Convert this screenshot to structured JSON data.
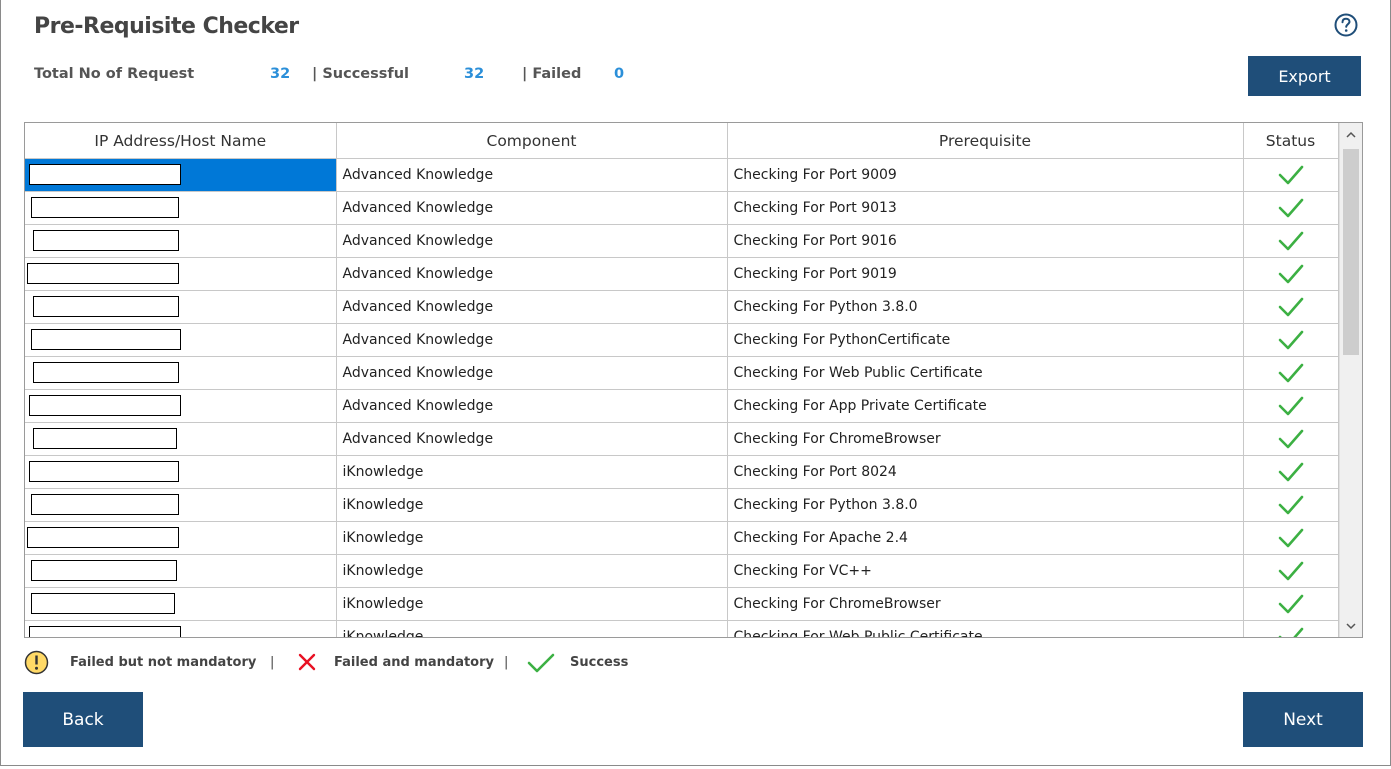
{
  "title": "Pre-Requisite Checker",
  "stats": {
    "total_label": "Total No of Request",
    "total_value": "32",
    "success_label": "| Successful",
    "success_value": "32",
    "failed_label": "| Failed",
    "failed_value": "0"
  },
  "buttons": {
    "export": "Export",
    "back": "Back",
    "next": "Next"
  },
  "help_icon": "question-circle-icon",
  "table": {
    "headers": [
      "IP Address/Host Name",
      "Component",
      "Prerequisite",
      "Status"
    ],
    "rows": [
      {
        "component": "Advanced Knowledge",
        "prerequisite": "Checking For Port 9009",
        "status": "success"
      },
      {
        "component": "Advanced Knowledge",
        "prerequisite": "Checking For Port 9013",
        "status": "success"
      },
      {
        "component": "Advanced Knowledge",
        "prerequisite": "Checking For Port 9016",
        "status": "success"
      },
      {
        "component": "Advanced Knowledge",
        "prerequisite": "Checking For Port 9019",
        "status": "success"
      },
      {
        "component": "Advanced Knowledge",
        "prerequisite": "Checking For Python 3.8.0",
        "status": "success"
      },
      {
        "component": "Advanced Knowledge",
        "prerequisite": "Checking For PythonCertificate",
        "status": "success"
      },
      {
        "component": "Advanced Knowledge",
        "prerequisite": "Checking For Web Public Certificate",
        "status": "success"
      },
      {
        "component": "Advanced Knowledge",
        "prerequisite": "Checking For App Private Certificate",
        "status": "success"
      },
      {
        "component": "Advanced Knowledge",
        "prerequisite": "Checking For ChromeBrowser",
        "status": "success"
      },
      {
        "component": "iKnowledge",
        "prerequisite": "Checking For Port 8024",
        "status": "success"
      },
      {
        "component": "iKnowledge",
        "prerequisite": "Checking For Python 3.8.0",
        "status": "success"
      },
      {
        "component": "iKnowledge",
        "prerequisite": "Checking For Apache 2.4",
        "status": "success"
      },
      {
        "component": "iKnowledge",
        "prerequisite": "Checking For VC++",
        "status": "success"
      },
      {
        "component": "iKnowledge",
        "prerequisite": "Checking For ChromeBrowser",
        "status": "success"
      },
      {
        "component": "iKnowledge",
        "prerequisite": "Checking For Web Public Certificate",
        "status": "success"
      }
    ]
  },
  "legend": {
    "warning_label": "Failed but not mandatory",
    "separator1": "|",
    "failed_label": "Failed and mandatory",
    "separator2": "|",
    "success_label": "Success"
  },
  "colors": {
    "button_bg": "#1f4e79",
    "stat_value": "#2b8fd9",
    "success_check": "#3cb043",
    "failed_x": "#e81123",
    "warning_bg": "#ffd966",
    "selected_cell": "#0078d7"
  }
}
